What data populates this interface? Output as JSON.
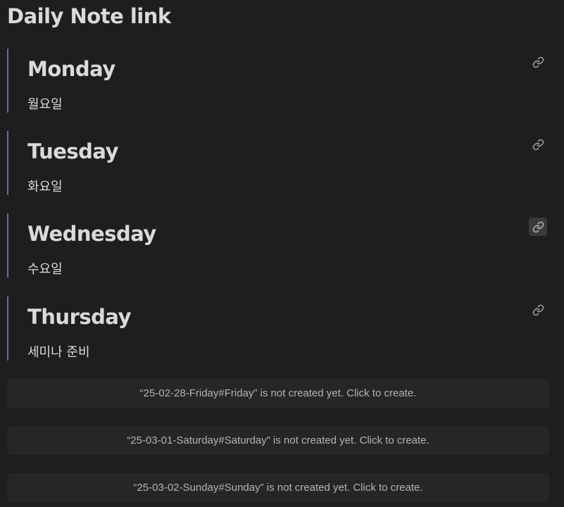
{
  "page": {
    "title": "Daily Note link"
  },
  "embeds": [
    {
      "heading": "Monday",
      "body": "월요일"
    },
    {
      "heading": "Tuesday",
      "body": "화요일"
    },
    {
      "heading": "Wednesday",
      "body": "수요일"
    },
    {
      "heading": "Thursday",
      "body": "세미나 준비"
    }
  ],
  "link_icon": "link-icon",
  "accent_color": "#7b5cc9",
  "placeholders": [
    {
      "text": "“25-02-28-Friday#Friday” is not created yet. Click to create."
    },
    {
      "text": "“25-03-01-Saturday#Saturday” is not created yet. Click to create."
    },
    {
      "text": "“25-03-02-Sunday#Sunday” is not created yet. Click to create."
    }
  ]
}
